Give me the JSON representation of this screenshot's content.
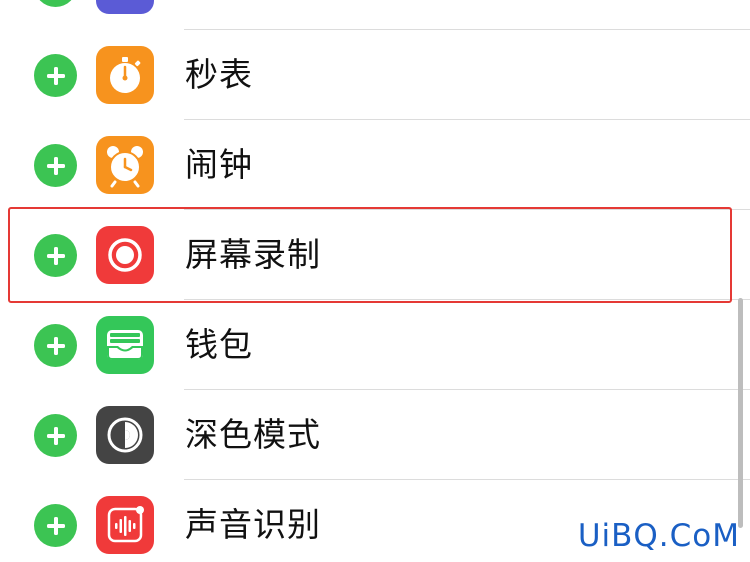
{
  "items": [
    {
      "label": "",
      "icon": "control-icon",
      "color": "#5b5bd6"
    },
    {
      "label": "秒表",
      "icon": "stopwatch-icon",
      "color": "#f7931e"
    },
    {
      "label": "闹钟",
      "icon": "alarm-clock-icon",
      "color": "#f7931e"
    },
    {
      "label": "屏幕录制",
      "icon": "screen-record-icon",
      "color": "#f03a3a"
    },
    {
      "label": "钱包",
      "icon": "wallet-icon",
      "color": "#34c759"
    },
    {
      "label": "深色模式",
      "icon": "dark-mode-icon",
      "color": "#444444"
    },
    {
      "label": "声音识别",
      "icon": "sound-recognition-icon",
      "color": "#f03a3a"
    }
  ],
  "watermark": "UiBQ.CoM",
  "colors": {
    "add": "#3cc453",
    "highlight": "#e53935",
    "watermark": "#1a5fc4"
  }
}
